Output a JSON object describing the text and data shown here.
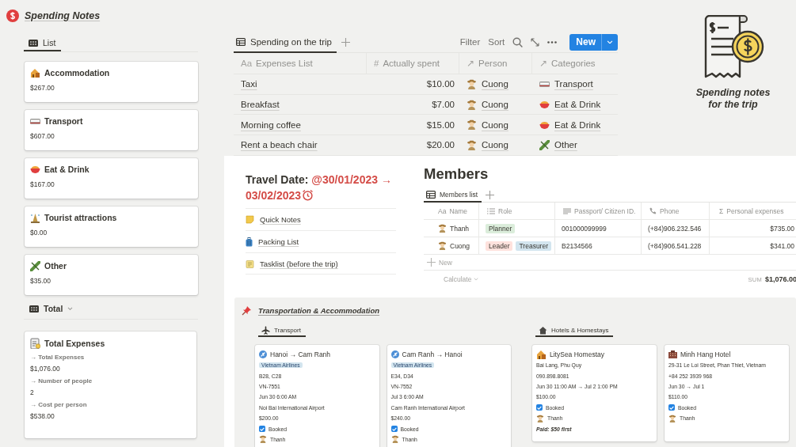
{
  "page": {
    "title": "Spending Notes"
  },
  "sidebar": {
    "list_tab": {
      "label": "List",
      "selected": true
    },
    "categories": [
      {
        "name": "Accommodation",
        "amount": "$267.00"
      },
      {
        "name": "Transport",
        "amount": "$607.00"
      },
      {
        "name": "Eat & Drink",
        "amount": "$167.00"
      },
      {
        "name": "Tourist attractions",
        "amount": "$0.00"
      },
      {
        "name": "Other",
        "amount": "$35.00"
      }
    ],
    "total_tab": {
      "label": "Total"
    },
    "total_card": {
      "title": "Total Expenses",
      "fields": [
        {
          "label": "→ Total Expenses",
          "value": "$1,076.00"
        },
        {
          "label": "→ Number of people",
          "value": "2"
        },
        {
          "label": "→ Cost per person",
          "value": "$538.00"
        }
      ]
    }
  },
  "expenses": {
    "tabs": [
      {
        "label": "Spending on the trip",
        "selected": true
      }
    ],
    "toolbar": [
      "Filter",
      "Sort"
    ],
    "new_button": "New",
    "columns": [
      {
        "kind": "title",
        "icon": "Aa",
        "label": "Expenses List"
      },
      {
        "kind": "number",
        "icon": "#",
        "label": "Actually spent"
      },
      {
        "kind": "person",
        "icon": "↗",
        "label": "Person"
      },
      {
        "kind": "category",
        "icon": "↗",
        "label": "Categories"
      }
    ],
    "rows": [
      [
        "Taxi",
        "$10.00",
        "Cuong",
        "Transport"
      ],
      [
        "Breakfast",
        "$7.00",
        "Cuong",
        "Eat & Drink"
      ],
      [
        "Morning coffee",
        "$15.00",
        "Cuong",
        "Eat & Drink"
      ],
      [
        "Rent a beach chair",
        "$20.00",
        "Cuong",
        "Other"
      ]
    ]
  },
  "cover": {
    "caption": "Spending notes for the trip"
  },
  "travel": {
    "label": "Travel Date:",
    "date": "@30/01/2023 → 03/02/2023",
    "links": [
      "Quick Notes",
      "Packing List",
      "Tasklist (before the trip)"
    ]
  },
  "members": {
    "title": "Members",
    "tabs": [
      {
        "label": "Members list",
        "selected": true
      }
    ],
    "columns": [
      {
        "kind": "title",
        "icon": "Aa",
        "label": "Name"
      },
      {
        "kind": "select",
        "label": "Role"
      },
      {
        "kind": "text",
        "label": "Passport/ Citizen ID."
      },
      {
        "kind": "phone",
        "label": "Phone"
      },
      {
        "kind": "formula",
        "icon": "Σ",
        "label": "Personal expenses"
      }
    ],
    "rows": [
      {
        "name": "Thanh",
        "roles": [
          {
            "label": "Planner",
            "color": "#dbeddb"
          }
        ],
        "id": "001000099999",
        "phone": "(+84)906.232.546",
        "expenses": "$735.00"
      },
      {
        "name": "Cuong",
        "roles": [
          {
            "label": "Leader",
            "color": "#ffe2dd"
          },
          {
            "label": "Treasurer",
            "color": "#d3e5ef"
          }
        ],
        "id": "B2134566",
        "phone": "(+84)906.541.228",
        "expenses": "$341.00"
      }
    ],
    "new_label": "New",
    "calculate": "Calculate",
    "sum_label": "SUM",
    "sum": "$1,076.00"
  },
  "callout": {
    "title": "Transportation & Accommodation",
    "boards": [
      {
        "kind": "transport",
        "tab": {
          "label": "Transport",
          "selected": true
        },
        "cards": [
          {
            "title": "Hanoi → Cam Ranh",
            "lines": [
              {
                "kind": "tag",
                "text": "Vietnam Airlines"
              },
              {
                "kind": "text",
                "text": "B28, C28"
              },
              {
                "kind": "text",
                "text": "VN-7551"
              },
              {
                "kind": "text",
                "text": "Jun 30 6:00 AM"
              },
              {
                "kind": "text",
                "text": "Noi Bai International Airport"
              },
              {
                "kind": "text",
                "text": "$200.00"
              },
              {
                "kind": "check",
                "text": "Booked",
                "checked": true
              },
              {
                "kind": "person",
                "text": "Thanh"
              }
            ]
          },
          {
            "title": "Cam Ranh → Hanoi",
            "lines": [
              {
                "kind": "tag",
                "text": "Vietnam Airlines"
              },
              {
                "kind": "text",
                "text": "E34, D34"
              },
              {
                "kind": "text",
                "text": "VN-7552"
              },
              {
                "kind": "text",
                "text": "Jul 3 6:00 AM"
              },
              {
                "kind": "text",
                "text": "Cam Ranh International Airport"
              },
              {
                "kind": "text",
                "text": "$240.00"
              },
              {
                "kind": "check",
                "text": "Booked",
                "checked": true
              },
              {
                "kind": "person",
                "text": "Thanh"
              }
            ]
          }
        ]
      },
      {
        "kind": "hotels",
        "tab": {
          "label": "Hotels & Homestays",
          "selected": true
        },
        "cards": [
          {
            "title": "LitySea Homestay",
            "lines": [
              {
                "kind": "text",
                "text": "Bai Lang, Phu Quy"
              },
              {
                "kind": "text",
                "text": "090.898.8081"
              },
              {
                "kind": "text",
                "text": "Jun 30 11:00 AM → Jul 2 1:00 PM"
              },
              {
                "kind": "text",
                "text": "$100.00"
              },
              {
                "kind": "check",
                "text": "Booked",
                "checked": true
              },
              {
                "kind": "person",
                "text": "Thanh"
              },
              {
                "kind": "note",
                "text": "Paid: $50 first"
              }
            ]
          },
          {
            "title": "Minh Hang Hotel",
            "lines": [
              {
                "kind": "text",
                "text": "29-31 Le Loi Street, Phan Thiet, Vietnam"
              },
              {
                "kind": "text",
                "text": "+84 252 3939 968"
              },
              {
                "kind": "text",
                "text": "Jun 30 → Jul 1"
              },
              {
                "kind": "text",
                "text": "$110.00"
              },
              {
                "kind": "check",
                "text": "Booked",
                "checked": true
              },
              {
                "kind": "person",
                "text": "Thanh"
              }
            ]
          }
        ]
      }
    ]
  }
}
